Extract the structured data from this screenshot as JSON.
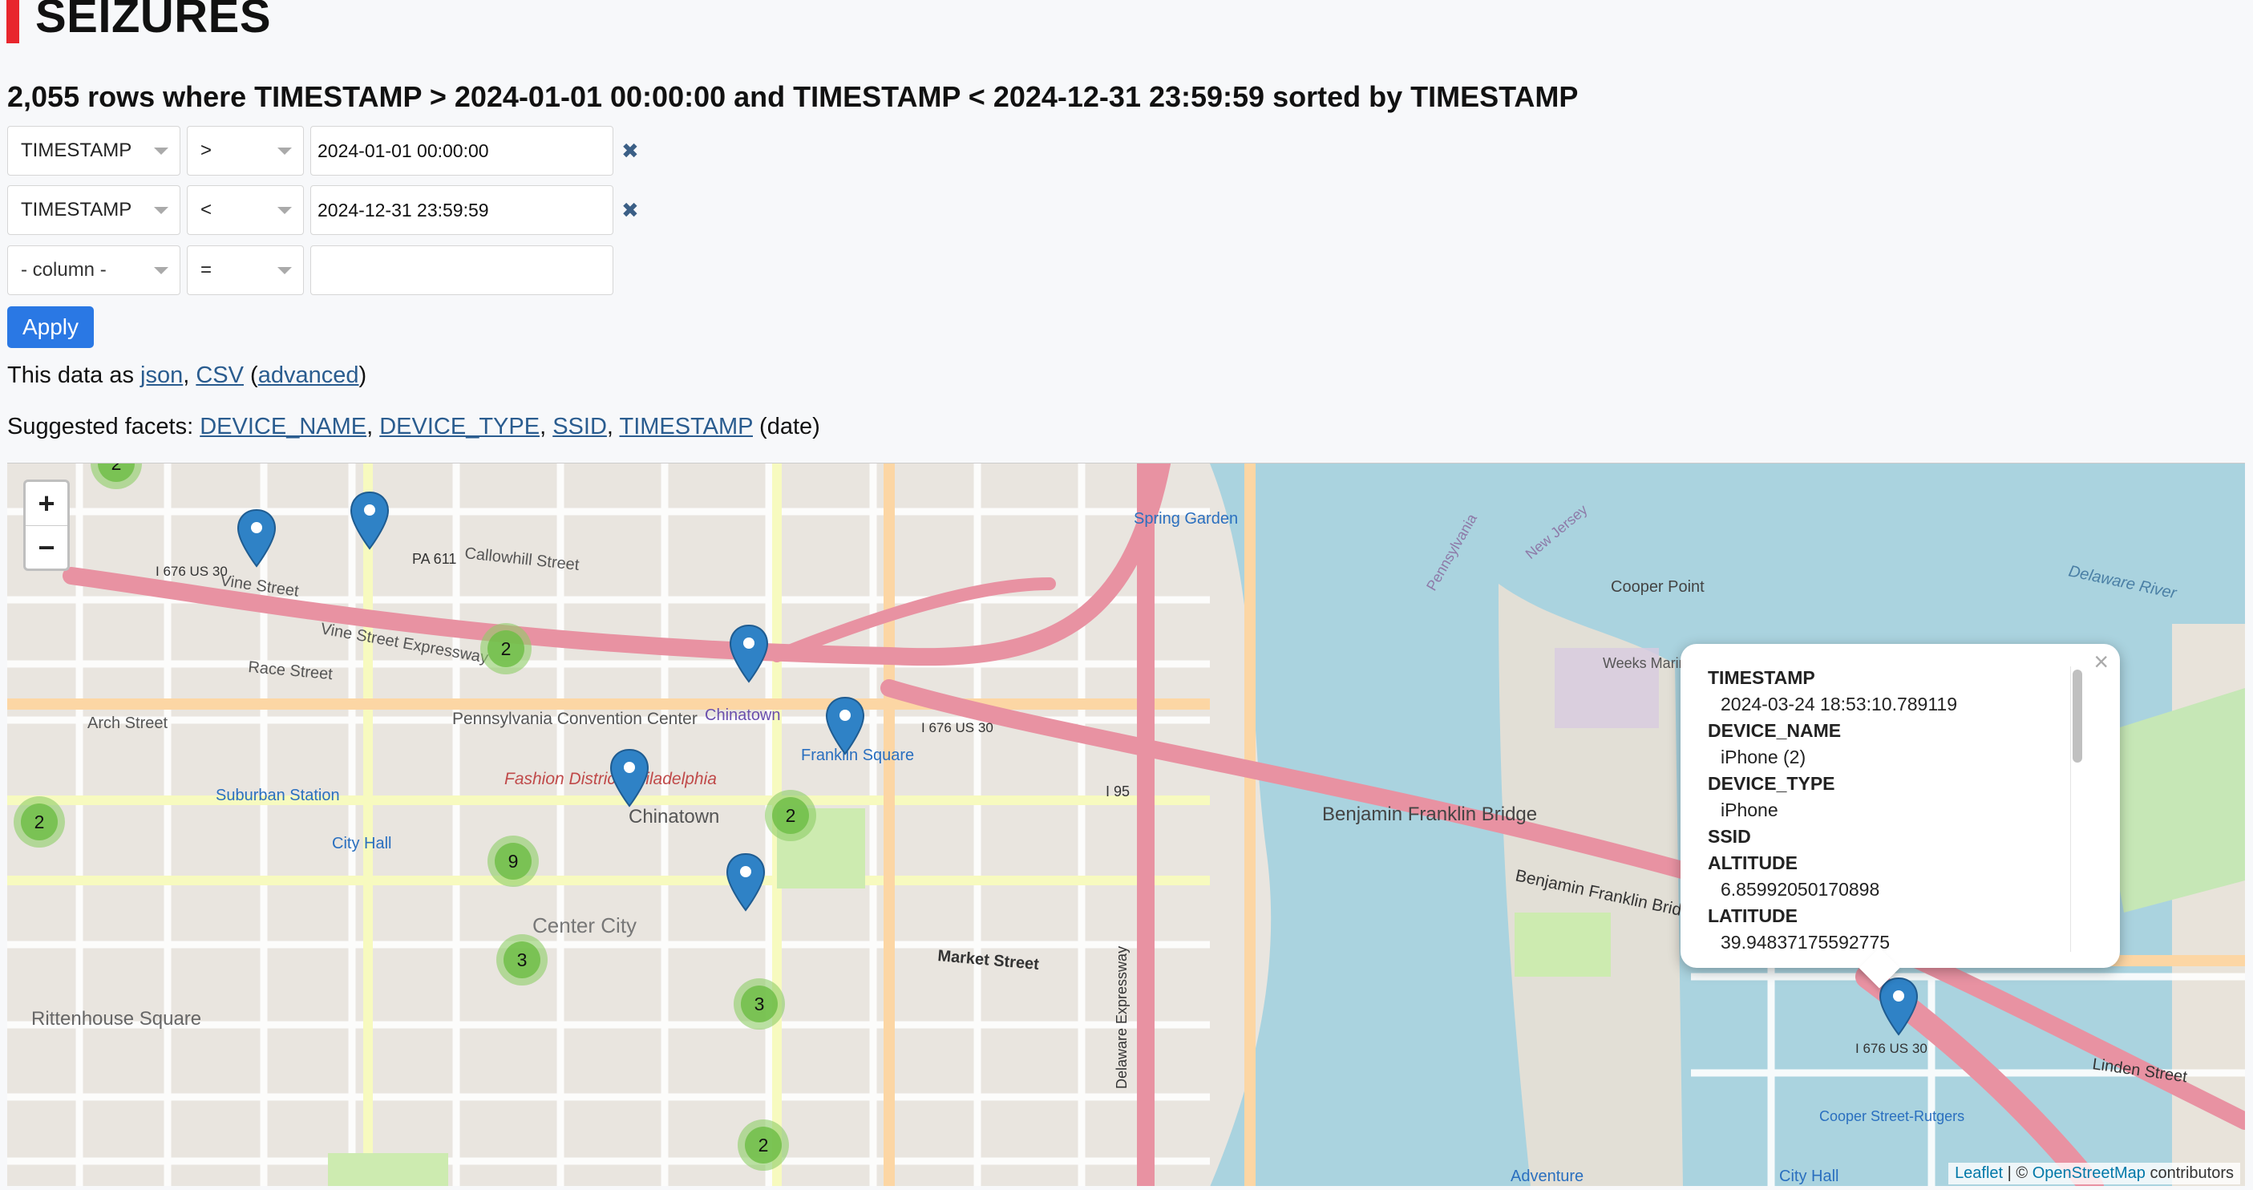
{
  "page": {
    "title": "SEIZURES",
    "summary": "2,055 rows where TIMESTAMP > 2024-01-01 00:00:00 and TIMESTAMP < 2024-12-31 23:59:59 sorted by TIMESTAMP"
  },
  "filters": [
    {
      "column": "TIMESTAMP",
      "op": ">",
      "value": "2024-01-01 00:00:00"
    },
    {
      "column": "TIMESTAMP",
      "op": "<",
      "value": "2024-12-31 23:59:59"
    },
    {
      "column": "- column -",
      "op": "=",
      "value": ""
    }
  ],
  "apply_label": "Apply",
  "export": {
    "prefix": "This data as ",
    "json": "json",
    "sep": ", ",
    "csv": "CSV",
    "open": " (",
    "advanced": "advanced",
    "close": ")"
  },
  "facets": {
    "prefix": "Suggested facets: ",
    "items": [
      "DEVICE_NAME",
      "DEVICE_TYPE",
      "SSID",
      "TIMESTAMP"
    ],
    "suffix": " (date)"
  },
  "map": {
    "zoom_in": "+",
    "zoom_out": "−",
    "attribution": {
      "leaflet": "Leaflet",
      "sep": " | © ",
      "osm": "OpenStreetMap",
      "rest": " contributors"
    },
    "labels": {
      "spring_garden": "Spring Garden",
      "vine_street": "Vine Street",
      "vine_expressway": "Vine Street Expressway",
      "callowhill": "Callowhill Street",
      "race_street": "Race Street",
      "arch_street": "Arch Street",
      "chinatown1": "Chinatown",
      "chinatown2": "Chinatown",
      "franklin_square": "Franklin Square",
      "convention": "Pennsylvania Convention Center",
      "fashion": "Fashion District Philadelphia",
      "suburban": "Suburban Station",
      "city_hall": "City Hall",
      "center_city": "Center City",
      "market_street": "Market Street",
      "rittenhouse": "Rittenhouse Square",
      "ben_franklin_bridge": "Benjamin Franklin Bridge",
      "bfb_road": "Benjamin Franklin Bridge",
      "delaware_river": "Delaware River",
      "cooper_point": "Cooper Point",
      "weeks_marine": "Weeks Marine",
      "delaware_expressway": "Delaware Expressway",
      "linden_street": "Linden Street",
      "cooper_rutgers": "Cooper Street-Rutgers",
      "adventure": "Adventure",
      "city_hall_camden": "City Hall",
      "pa611": "PA 611",
      "i676_1": "I 676 US 30",
      "i676_2": "I 676 US 30",
      "i676_3": "I 676 US 30",
      "i95": "I 95",
      "new_jersey": "New Jersey",
      "pennsylvania": "Pennsylvania"
    },
    "clusters": [
      "2",
      "2",
      "2",
      "9",
      "3",
      "3",
      "2",
      "2"
    ],
    "popup": {
      "fields": [
        {
          "key": "TIMESTAMP",
          "value": "2024-03-24 18:53:10.789119"
        },
        {
          "key": "DEVICE_NAME",
          "value": "iPhone (2)"
        },
        {
          "key": "DEVICE_TYPE",
          "value": "iPhone"
        },
        {
          "key": "SSID",
          "value": ""
        },
        {
          "key": "ALTITUDE",
          "value": "6.85992050170898"
        },
        {
          "key": "LATITUDE",
          "value": "39.94837175592775"
        }
      ]
    }
  }
}
